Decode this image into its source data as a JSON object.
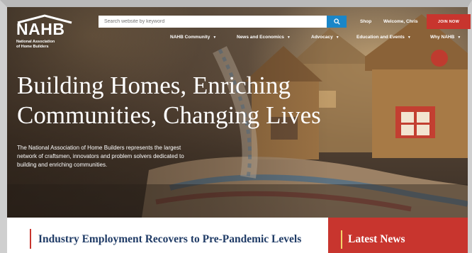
{
  "brand": {
    "logo_text": "NAHB",
    "logo_sub_line1": "National Association",
    "logo_sub_line2": "of Home Builders"
  },
  "search": {
    "placeholder": "Search website by keyword"
  },
  "top_links": {
    "shop": "Shop",
    "welcome": "Welcome, Chris",
    "join": "JOIN NOW"
  },
  "nav": {
    "items": [
      {
        "label": "NAHB Community"
      },
      {
        "label": "News and Economics"
      },
      {
        "label": "Advocacy"
      },
      {
        "label": "Education and Events"
      },
      {
        "label": "Why NAHB"
      }
    ]
  },
  "hero": {
    "headline_line1": "Building Homes, Enriching",
    "headline_line2": "Communities, Changing Lives",
    "description_line1": "The National Association of Home Builders represents the largest",
    "description_line2": "network of craftsmen, innovators and problem solvers dedicated to",
    "description_line3": "building and enriching communities."
  },
  "featured": {
    "title": "Industry Employment Recovers to Pre-Pandemic Levels"
  },
  "latest_news": {
    "title": "Latest News"
  },
  "colors": {
    "accent_red": "#c8352e",
    "search_blue": "#1a86c8",
    "headline_navy": "#1f3b66",
    "accent_gold": "#f3d36b"
  }
}
